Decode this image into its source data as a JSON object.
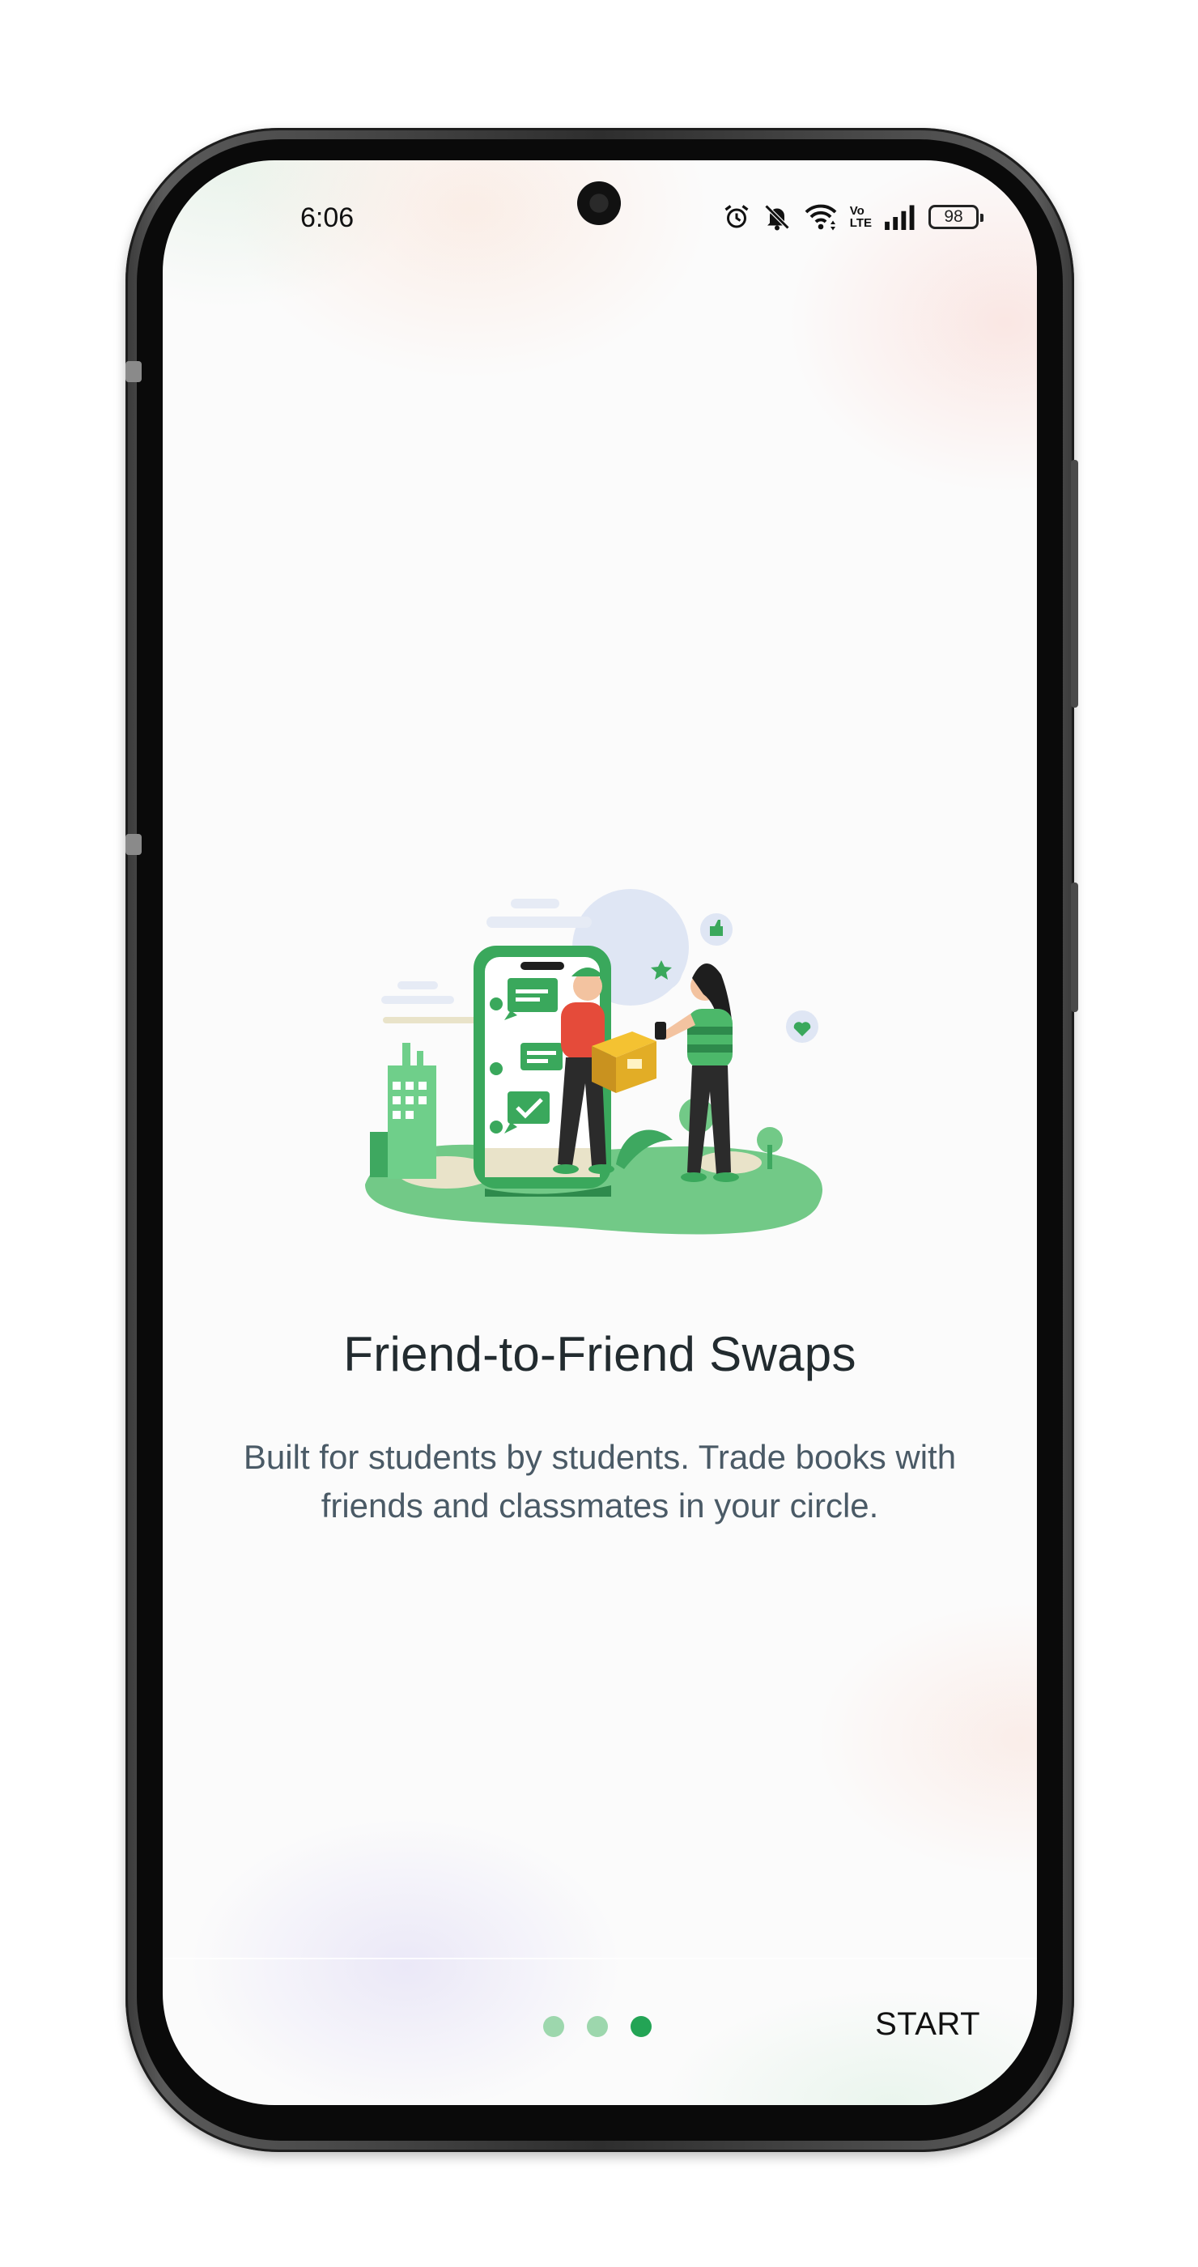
{
  "status_bar": {
    "time": "6:06",
    "battery": "98",
    "icons": [
      "alarm-icon",
      "mute-icon",
      "wifi-icon",
      "volte-icon",
      "signal-icon",
      "battery-icon"
    ],
    "volte_label_top": "Vo",
    "volte_label_bottom": "LTE"
  },
  "onboarding": {
    "title": "Friend-to-Friend Swaps",
    "description": "Built for students by students. Trade books with friends and classmates in your circle.",
    "page_count": 3,
    "active_page": 3,
    "start_label": "START"
  },
  "colors": {
    "accent": "#23a455",
    "dot_inactive": "#9dd7ad",
    "title": "#222b2f",
    "body_text": "#4a5a66"
  }
}
